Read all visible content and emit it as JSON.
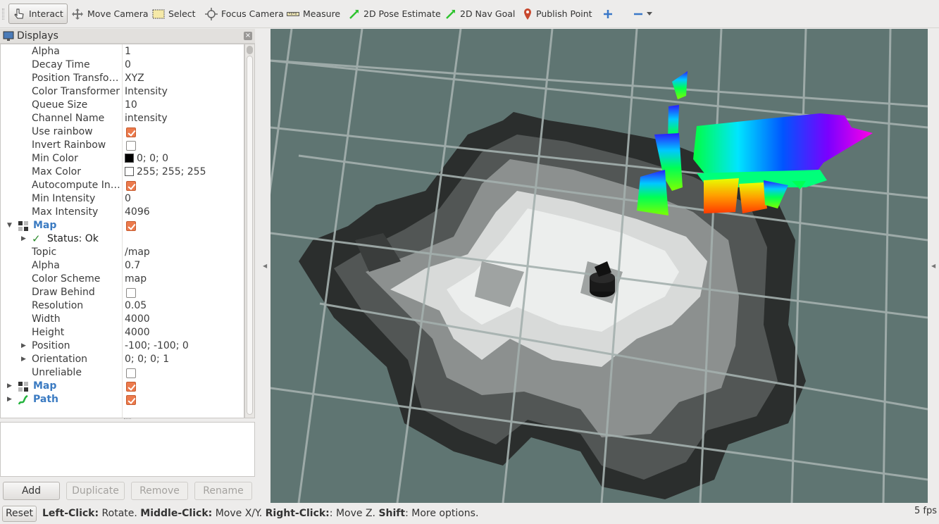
{
  "toolbar": {
    "tools": [
      {
        "label": "Interact",
        "icon": "cursor-hand-icon"
      },
      {
        "label": "Move Camera",
        "icon": "move-camera-icon"
      },
      {
        "label": "Select",
        "icon": "select-rect-icon"
      },
      {
        "label": "Focus Camera",
        "icon": "focus-camera-icon"
      },
      {
        "label": "Measure",
        "icon": "ruler-icon"
      },
      {
        "label": "2D Pose Estimate",
        "icon": "green-arrow-icon"
      },
      {
        "label": "2D Nav Goal",
        "icon": "green-arrow-icon"
      },
      {
        "label": "Publish Point",
        "icon": "map-pin-icon"
      }
    ]
  },
  "displays_panel": {
    "title": "Displays",
    "close_glyph": "×",
    "rows": [
      {
        "label": "Alpha",
        "value": "1"
      },
      {
        "label": "Decay Time",
        "value": "0"
      },
      {
        "label": "Position Transfo…",
        "value": "XYZ"
      },
      {
        "label": "Color Transformer",
        "value": "Intensity"
      },
      {
        "label": "Queue Size",
        "value": "10"
      },
      {
        "label": "Channel Name",
        "value": "intensity"
      },
      {
        "label": "Use rainbow",
        "checked": true
      },
      {
        "label": "Invert Rainbow",
        "checked": false
      },
      {
        "label": "Min Color",
        "value": "0; 0; 0",
        "swatch": "#000000"
      },
      {
        "label": "Max Color",
        "value": "255; 255; 255",
        "swatch": "#ffffff"
      },
      {
        "label": "Autocompute In…",
        "checked": true
      },
      {
        "label": "Min Intensity",
        "value": "0"
      },
      {
        "label": "Max Intensity",
        "value": "4096"
      }
    ],
    "map_display": {
      "name": "Map",
      "checked": true,
      "status": "Status: Ok",
      "rows": [
        {
          "label": "Topic",
          "value": "/map"
        },
        {
          "label": "Alpha",
          "value": "0.7"
        },
        {
          "label": "Color Scheme",
          "value": "map"
        },
        {
          "label": "Draw Behind",
          "checked": false
        },
        {
          "label": "Resolution",
          "value": "0.05"
        },
        {
          "label": "Width",
          "value": "4000"
        },
        {
          "label": "Height",
          "value": "4000"
        },
        {
          "label": "Position",
          "value": "-100; -100; 0"
        },
        {
          "label": "Orientation",
          "value": "0; 0; 0; 1"
        },
        {
          "label": "Unreliable",
          "checked": false
        }
      ]
    },
    "other_displays": [
      {
        "name": "Map",
        "checked": true
      },
      {
        "name": "Path",
        "checked": true
      }
    ],
    "buttons": {
      "add": "Add",
      "duplicate": "Duplicate",
      "remove": "Remove",
      "rename": "Rename"
    }
  },
  "statusbar": {
    "reset": "Reset",
    "hint_parts": [
      {
        "bold": "Left-Click:",
        "text": " Rotate. "
      },
      {
        "bold": "Middle-Click:",
        "text": " Move X/Y. "
      },
      {
        "bold": "Right-Click:",
        "text": ": Move Z. "
      },
      {
        "bold": "Shift",
        "text": ": More options."
      }
    ],
    "fps": "5 fps"
  },
  "colors": {
    "view_background": "#5f7572",
    "grid": "#a4b0ae",
    "checkbox_on": "#ec7a4c",
    "display_name": "#3b7bc2"
  }
}
